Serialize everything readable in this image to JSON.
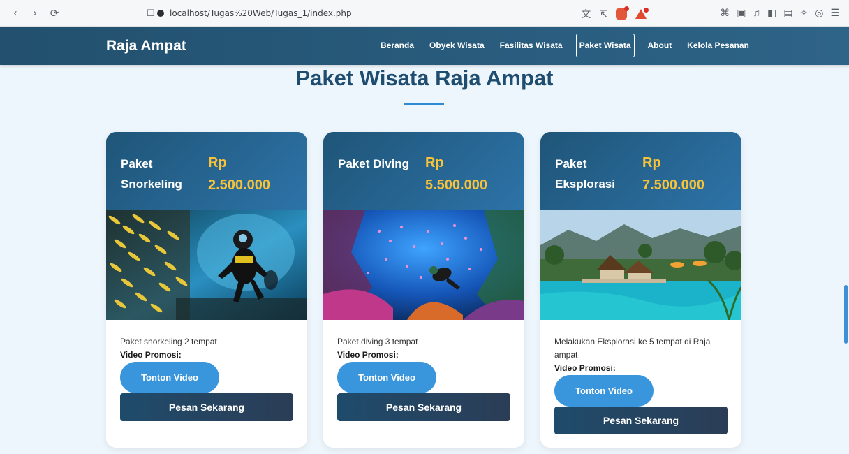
{
  "browser": {
    "url": "localhost/Tugas%20Web/Tugas_1/index.php",
    "back": "‹",
    "forward": "›",
    "reload": "⟳"
  },
  "nav": {
    "brand": "Raja Ampat",
    "items": [
      {
        "label": "Beranda",
        "active": false
      },
      {
        "label": "Obyek Wisata",
        "active": false
      },
      {
        "label": "Fasilitas Wisata",
        "active": false
      },
      {
        "label": "Paket Wisata",
        "active": true
      },
      {
        "label": "About",
        "active": false
      },
      {
        "label": "Kelola Pesanan",
        "active": false
      }
    ]
  },
  "page": {
    "title": "Paket Wisata Raja Ampat"
  },
  "cards": [
    {
      "name": "Paket Snorkeling",
      "price_prefix": "Rp",
      "price": "2.500.000",
      "image": "snorkeling-diver-photo",
      "description": "Paket snorkeling 2 tempat",
      "promo_label": "Video Promosi:",
      "watch_label": "Tonton Video",
      "order_label": "Pesan Sekarang"
    },
    {
      "name": "Paket Diving",
      "price_prefix": "Rp",
      "price": "5.500.000",
      "image": "coral-reef-diver-photo",
      "description": "Paket diving 3 tempat",
      "promo_label": "Video Promosi:",
      "watch_label": "Tonton Video",
      "order_label": "Pesan Sekarang"
    },
    {
      "name": "Paket Eksplorasi",
      "price_prefix": "Rp",
      "price": "7.500.000",
      "image": "resort-pool-photo",
      "description": "Melakukan Eksplorasi ke 5 tempat di Raja ampat",
      "promo_label": "Video Promosi:",
      "watch_label": "Tonton Video",
      "order_label": "Pesan Sekarang"
    }
  ],
  "colors": {
    "nav_bg": "#22506e",
    "price": "#f8c338",
    "watch_button": "#3a96dc",
    "order_button": "#1f4b6b",
    "title": "#1f4d70"
  }
}
